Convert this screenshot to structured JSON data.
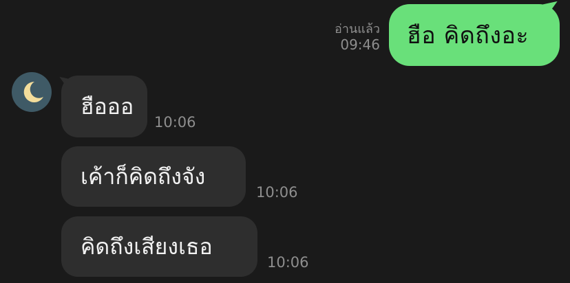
{
  "outgoing": {
    "text": "ฮือ คิดถึงอะ",
    "read_label": "อ่านแล้ว",
    "time": "09:46"
  },
  "contact": {
    "avatar_icon": "crescent-moon-icon"
  },
  "incoming": [
    {
      "text": "ฮือออ",
      "time": "10:06"
    },
    {
      "text": "เค้าก็คิดถึงจัง",
      "time": "10:06"
    },
    {
      "text": "คิดถึงเสียงเธอ",
      "time": "10:06"
    }
  ],
  "colors": {
    "background": "#1a1a1a",
    "outgoing_bubble": "#69e07a",
    "incoming_bubble": "#2e2e2e",
    "meta_text": "#8e8e8e",
    "avatar_bg": "#3f5a66",
    "moon": "#f3dd9b"
  }
}
